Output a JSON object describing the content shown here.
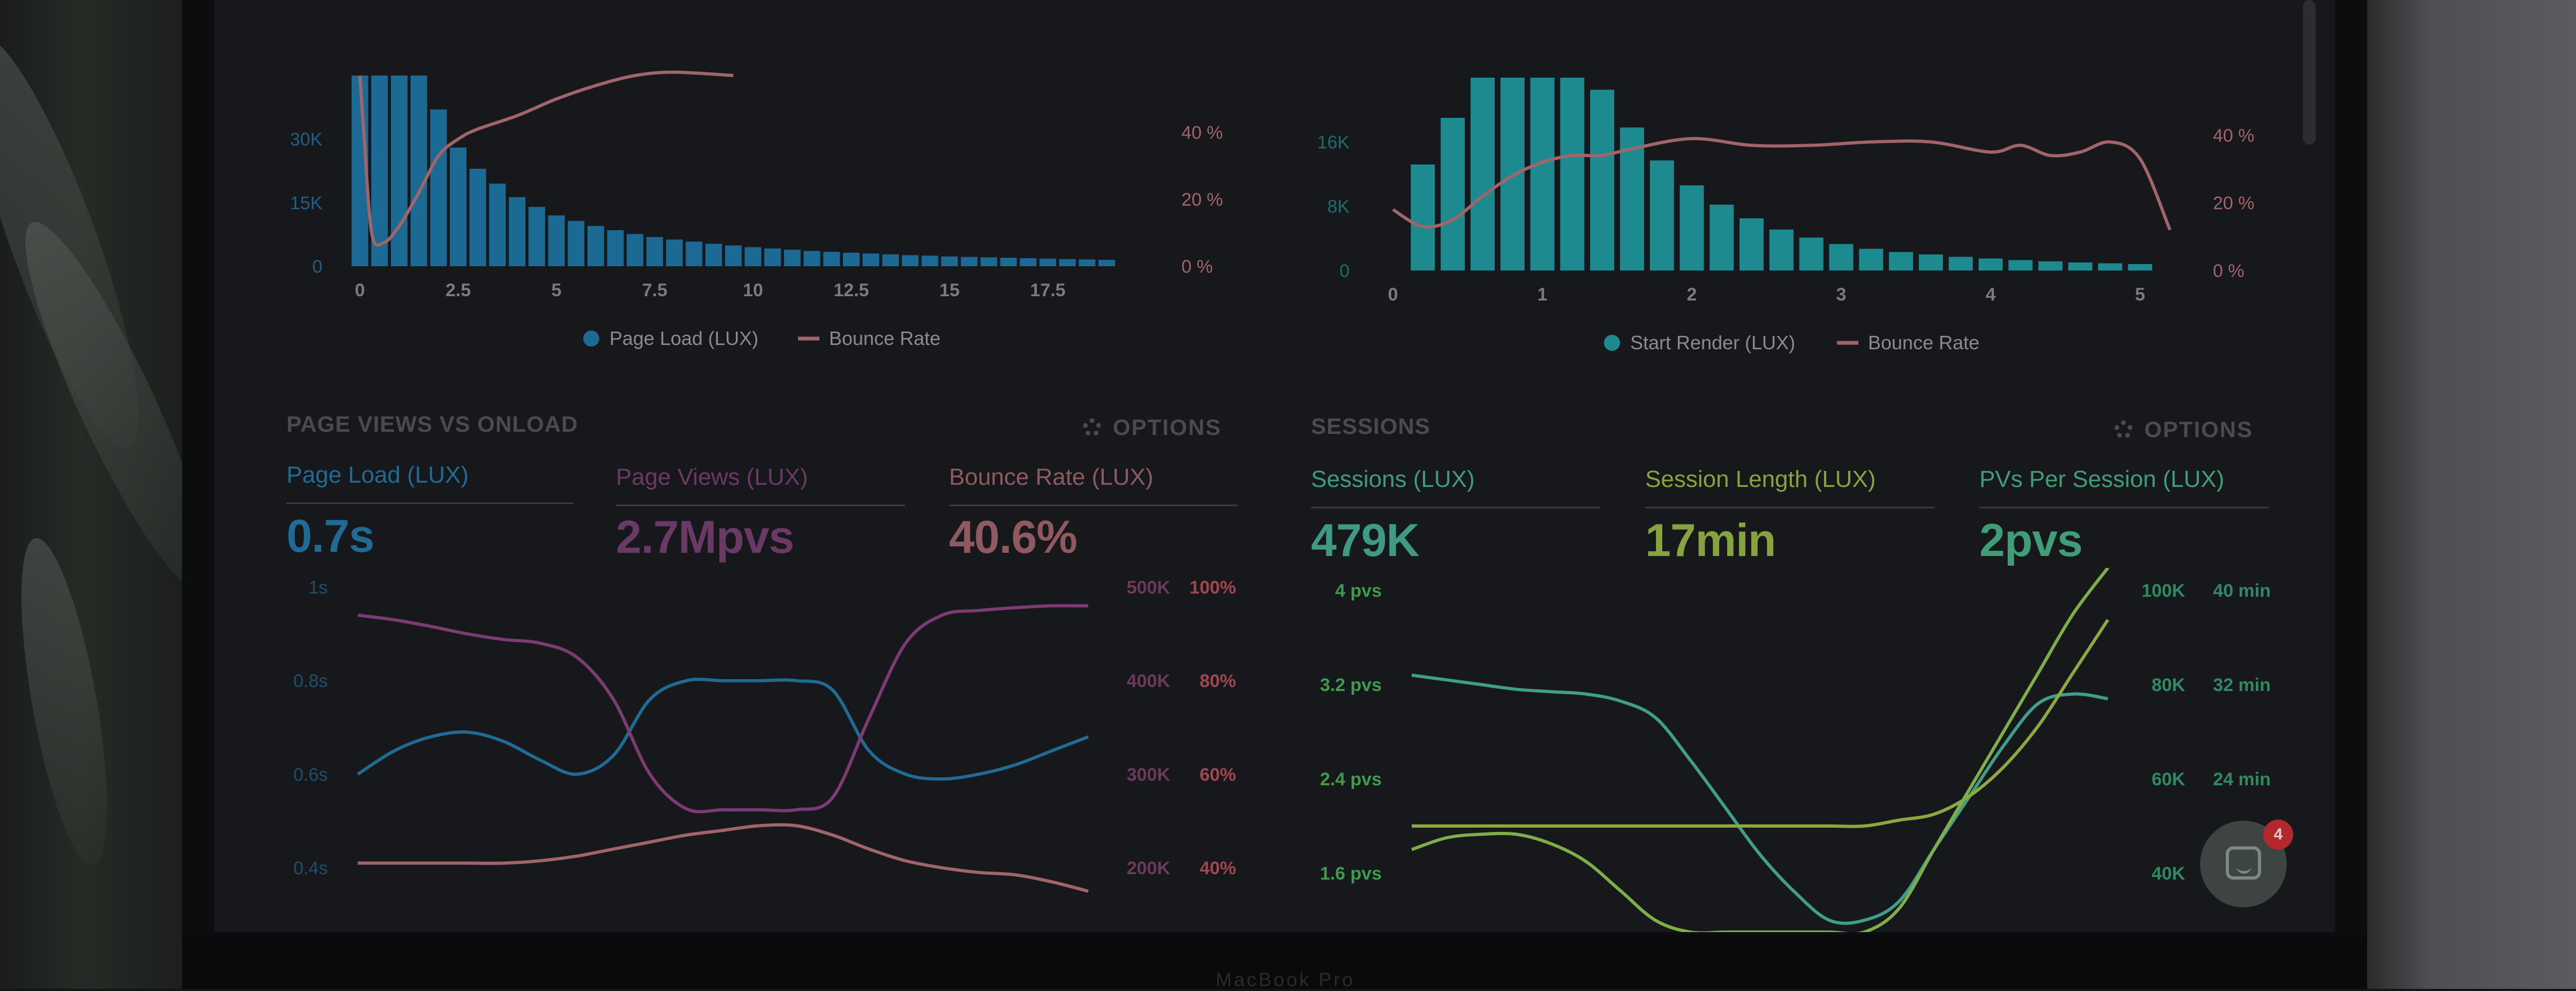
{
  "colors": {
    "blue": "#1f6b95",
    "blue_bar": "#1b6a94",
    "teal": "#1c8a8f",
    "pink": "#a0646b",
    "purple": "#7d3b73",
    "green": "#41a27d",
    "lime": "#8da83f",
    "axis": "#6b6c70"
  },
  "top_left": {
    "legend": [
      "Page Load (LUX)",
      "Bounce Rate"
    ]
  },
  "top_right": {
    "legend": [
      "Start Render (LUX)",
      "Bounce Rate"
    ]
  },
  "pvo": {
    "title": "PAGE VIEWS VS ONLOAD",
    "options": "OPTIONS",
    "metrics": [
      {
        "label": "Page Load (LUX)",
        "value": "0.7s"
      },
      {
        "label": "Page Views (LUX)",
        "value": "2.7Mpvs"
      },
      {
        "label": "Bounce Rate (LUX)",
        "value": "40.6%"
      }
    ]
  },
  "sessions": {
    "title": "SESSIONS",
    "options": "OPTIONS",
    "metrics": [
      {
        "label": "Sessions (LUX)",
        "value": "479K"
      },
      {
        "label": "Session Length (LUX)",
        "value": "17min"
      },
      {
        "label": "PVs Per Session (LUX)",
        "value": "2pvs"
      }
    ]
  },
  "chat": {
    "icon": "chat-icon",
    "badge": "4"
  },
  "chart_data": [
    {
      "type": "bar",
      "y_ticks": [
        "0",
        "15K",
        "30K"
      ],
      "ylim": [
        0,
        45000
      ],
      "x_ticks": [
        "0",
        "2.5",
        "5",
        "7.5",
        "10",
        "12.5",
        "15",
        "17.5"
      ],
      "xlim": [
        0,
        20
      ],
      "y2_ticks": [
        "0 %",
        "20 %",
        "40 %"
      ],
      "y2lim": [
        0,
        57
      ],
      "series": [
        {
          "name": "Page Load (LUX)",
          "x": [
            0,
            0.5,
            1,
            1.5,
            2,
            2.5,
            3,
            3.5,
            4,
            4.5,
            5,
            5.5,
            6,
            6.5,
            7,
            7.5,
            8,
            8.5,
            9,
            9.5,
            10,
            10.5,
            11,
            11.5,
            12,
            12.5,
            13,
            13.5,
            14,
            14.5,
            15,
            15.5,
            16,
            16.5,
            17,
            17.5,
            18,
            18.5,
            19
          ],
          "values": [
            45000,
            45000,
            45000,
            45000,
            37000,
            28000,
            23000,
            19500,
            16300,
            14000,
            12000,
            10700,
            9500,
            8500,
            7600,
            6900,
            6300,
            5800,
            5300,
            4900,
            4500,
            4200,
            3900,
            3600,
            3400,
            3200,
            3000,
            2800,
            2600,
            2500,
            2300,
            2200,
            2100,
            2000,
            1900,
            1800,
            1700,
            1600,
            1500
          ]
        },
        {
          "name": "Bounce Rate",
          "x": [
            0,
            0.1,
            0.3,
            0.6,
            1,
            1.5,
            2,
            2.5,
            3,
            4,
            5,
            6,
            7,
            8,
            9.5
          ],
          "values": [
            57,
            40,
            10,
            7,
            12,
            22,
            33,
            38,
            41,
            45,
            50,
            54,
            57,
            58,
            57
          ]
        }
      ]
    },
    {
      "type": "bar",
      "y_ticks": [
        "0",
        "8K",
        "16K"
      ],
      "ylim": [
        0,
        24000
      ],
      "x_ticks": [
        "0",
        "1",
        "2",
        "3",
        "4",
        "5"
      ],
      "xlim": [
        0,
        5
      ],
      "y2_ticks": [
        "0 %",
        "20 %",
        "40 %"
      ],
      "y2lim": [
        0,
        57
      ],
      "series": [
        {
          "name": "Start Render (LUX)",
          "x": [
            0.2,
            0.4,
            0.6,
            0.8,
            1,
            1.2,
            1.4,
            1.6,
            1.8,
            2,
            2.2,
            2.4,
            2.6,
            2.8,
            3,
            3.2,
            3.4,
            3.6,
            3.8,
            4,
            4.2,
            4.4,
            4.6,
            4.8,
            5
          ],
          "values": [
            13200,
            19000,
            24000,
            24000,
            24000,
            24000,
            22500,
            17800,
            13700,
            10600,
            8200,
            6500,
            5100,
            4100,
            3300,
            2700,
            2300,
            2000,
            1700,
            1500,
            1300,
            1150,
            1000,
            900,
            800
          ]
        },
        {
          "name": "Bounce Rate",
          "x": [
            0,
            0.2,
            0.4,
            0.6,
            0.8,
            1,
            1.2,
            1.4,
            1.6,
            2,
            2.4,
            2.8,
            3.2,
            3.6,
            4,
            4.2,
            4.4,
            4.6,
            4.8,
            5,
            5.2
          ],
          "values": [
            18,
            13,
            15,
            22,
            28,
            32,
            34,
            34,
            36,
            39,
            37,
            37,
            38,
            38,
            35,
            37,
            34,
            35,
            38,
            33,
            12
          ]
        }
      ]
    },
    {
      "type": "line",
      "y_ticks": [
        "0.4s",
        "0.6s",
        "0.8s",
        "1s"
      ],
      "ylim": [
        0.4,
        1.0
      ],
      "y2_ticks": [
        "200K",
        "300K",
        "400K",
        "500K"
      ],
      "y2lim": [
        200000,
        500000
      ],
      "y3_ticks": [
        "40%",
        "60%",
        "80%",
        "100%"
      ],
      "y3lim": [
        40,
        100
      ],
      "x": [
        0,
        1,
        2,
        3,
        4,
        5,
        6,
        7,
        8,
        9,
        10,
        11,
        12,
        13,
        14,
        15,
        16,
        17,
        18,
        19,
        20
      ],
      "series": [
        {
          "name": "Page Load (LUX)",
          "values": [
            0.6,
            0.65,
            0.68,
            0.69,
            0.67,
            0.63,
            0.6,
            0.64,
            0.76,
            0.8,
            0.8,
            0.8,
            0.8,
            0.78,
            0.65,
            0.6,
            0.59,
            0.6,
            0.62,
            0.65,
            0.68
          ]
        },
        {
          "name": "Page Views (LUX)",
          "values": [
            470000,
            465000,
            458000,
            450000,
            444000,
            440000,
            425000,
            380000,
            300000,
            263000,
            262000,
            262000,
            262000,
            275000,
            360000,
            440000,
            470000,
            475000,
            478000,
            480000,
            480000
          ]
        },
        {
          "name": "Bounce Rate (LUX)",
          "values": [
            41,
            41,
            41,
            41,
            41,
            41.5,
            42.5,
            44,
            45.5,
            47,
            48,
            49,
            49,
            47,
            44,
            41.5,
            40,
            39,
            38.5,
            37,
            35
          ]
        }
      ]
    },
    {
      "type": "line",
      "y_ticks": [
        "1.6 pvs",
        "2.4 pvs",
        "3.2 pvs",
        "4 pvs"
      ],
      "ylim": [
        1.6,
        4.0
      ],
      "y2_ticks": [
        "40K",
        "60K",
        "80K",
        "100K"
      ],
      "y2lim": [
        40000,
        100000
      ],
      "y3_ticks": [
        "24 min",
        "32 min",
        "40 min"
      ],
      "y3lim": [
        16,
        40
      ],
      "x": [
        0,
        1,
        2,
        3,
        4,
        5,
        6,
        7,
        8,
        9,
        10,
        11,
        12,
        13,
        14,
        15,
        16,
        17,
        18,
        19,
        20
      ],
      "series": [
        {
          "name": "Sessions (LUX)",
          "values": [
            82000,
            81000,
            80000,
            79000,
            78500,
            78000,
            76500,
            73000,
            64000,
            54000,
            44000,
            36000,
            30000,
            30000,
            34000,
            45000,
            56000,
            67000,
            76000,
            78000,
            77000
          ]
        },
        {
          "name": "Session Length (LUX)",
          "values": [
            20,
            20,
            20,
            20,
            20,
            20,
            20,
            20,
            20,
            20,
            20,
            20,
            20,
            20,
            20.5,
            21,
            22.5,
            25,
            28.5,
            33,
            37.5
          ]
        },
        {
          "name": "PVs Per Session (LUX)",
          "values": [
            1.8,
            1.9,
            1.93,
            1.93,
            1.85,
            1.7,
            1.45,
            1.2,
            1.0,
            0.82,
            0.7,
            0.65,
            0.7,
            0.9,
            1.3,
            1.8,
            2.3,
            2.8,
            3.3,
            3.8,
            4.2
          ]
        }
      ]
    }
  ]
}
